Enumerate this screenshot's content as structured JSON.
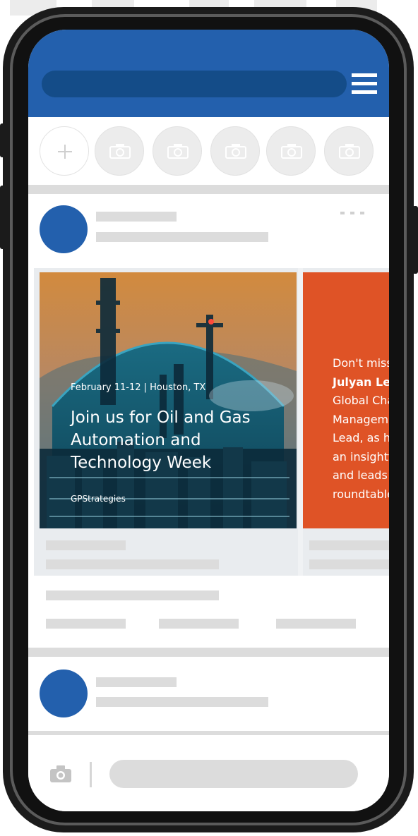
{
  "event_card": {
    "date_location": "February 11-12 | Houston, TX",
    "title": "Join us for Oil and Gas Automation and Technology Week",
    "logo_text": "GPStrategies"
  },
  "quote_card": {
    "line1": "Don't miss",
    "bold_name": "Julyan Lee",
    "rest": ", c\nGlobal Chang\nManagemen\nLead, as he c\nan insightful\nand leads an\nroundtable c"
  },
  "colors": {
    "brand_blue": "#2360ad",
    "search_blue": "#144c88",
    "orange": "#df5326",
    "placeholder": "#dcdcdc"
  },
  "icons": [
    "menu-icon",
    "plus-icon",
    "camera-icon",
    "more-icon"
  ]
}
